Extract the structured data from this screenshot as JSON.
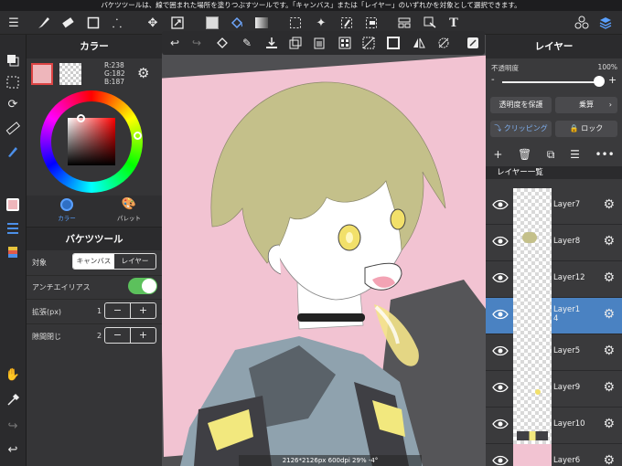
{
  "hint": "バケツツールは、線で囲まれた場所を塗りつぶすツールです。「キャンバス」または「レイヤー」のいずれかを対象として選択できます。",
  "color_panel": {
    "title": "カラー",
    "rgb_r": "R:238",
    "rgb_g": "G:182",
    "rgb_b": "B:187",
    "tab_color": "カラー",
    "tab_palette": "パレット",
    "main_color": "#eeb6bb"
  },
  "bucket": {
    "title": "バケツツール",
    "target_label": "対象",
    "target_canvas": "キャンバス",
    "target_layer": "レイヤー",
    "antialias_label": "アンチエイリアス",
    "expand_label": "拡張(px)",
    "expand_value": "1",
    "gap_label": "隙間閉じ",
    "gap_value": "2",
    "minus": "−",
    "plus": "+"
  },
  "layer_panel": {
    "title": "レイヤー",
    "opacity_label": "不透明度",
    "opacity_value": "100%",
    "opacity_minus": "-",
    "opacity_plus": "+",
    "protect_button": "透明度を保護",
    "blend_button": "乗算",
    "clipping_button": "クリッピング",
    "lock_button": "ロック",
    "list_title": "レイヤー一覧",
    "layers": [
      {
        "name": "Layer7"
      },
      {
        "name": "Layer8"
      },
      {
        "name": "Layer12"
      },
      {
        "name": "Layer1\n4",
        "selected": true
      },
      {
        "name": "Layer5"
      },
      {
        "name": "Layer9"
      },
      {
        "name": "Layer10"
      },
      {
        "name": "Layer6"
      }
    ]
  },
  "status": "2126*2126px 600dpi 29% -4°"
}
